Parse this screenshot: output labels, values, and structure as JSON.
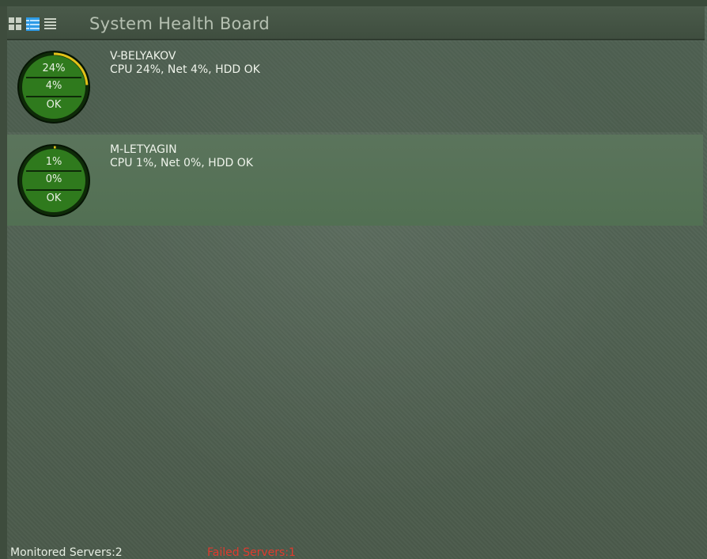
{
  "header": {
    "title": "System Health Board",
    "view_buttons": [
      {
        "name": "grid-view",
        "icon": "grid-icon",
        "active": false
      },
      {
        "name": "detail-view",
        "icon": "detail-list-icon",
        "active": true
      },
      {
        "name": "list-view",
        "icon": "list-icon",
        "active": false
      }
    ]
  },
  "servers": [
    {
      "name": "V-BELYAKOV",
      "status_line": "CPU 24%, Net 4%, HDD OK",
      "gauge": {
        "cpu": "24%",
        "net": "4%",
        "hdd": "OK",
        "cpu_fraction": 0.24
      },
      "highlighted": false
    },
    {
      "name": "M-LETYAGIN",
      "status_line": "CPU 1%, Net 0%, HDD OK",
      "gauge": {
        "cpu": "1%",
        "net": "0%",
        "hdd": "OK",
        "cpu_fraction": 0.01
      },
      "highlighted": true
    }
  ],
  "footer": {
    "monitored": "Monitored Servers:2",
    "failed": "Failed Servers:1"
  },
  "colors": {
    "background": "#4f5f4e",
    "gauge_ring": "#1c5a12",
    "gauge_fill": "#2f7a1d",
    "gauge_arc": "#e2c219",
    "failed_text": "#e03a2e",
    "active_view_icon": "#2e9be6"
  }
}
